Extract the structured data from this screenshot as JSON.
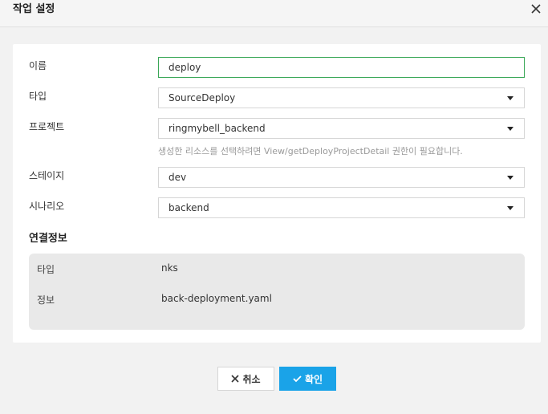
{
  "dialog": {
    "title": "작업 설정"
  },
  "form": {
    "name": {
      "label": "이름",
      "value": "deploy"
    },
    "type": {
      "label": "타입",
      "value": "SourceDeploy"
    },
    "project": {
      "label": "프로젝트",
      "value": "ringmybell_backend",
      "help": "생성한 리소스를 선택하려면 View/getDeployProjectDetail 권한이 필요합니다."
    },
    "stage": {
      "label": "스테이지",
      "value": "dev"
    },
    "scenario": {
      "label": "시나리오",
      "value": "backend"
    }
  },
  "connection": {
    "title": "연결정보",
    "rows": [
      {
        "label": "타입",
        "value": "nks"
      },
      {
        "label": "정보",
        "value": "back-deployment.yaml"
      }
    ]
  },
  "footer": {
    "cancel_label": "취소",
    "ok_label": "확인"
  },
  "colors": {
    "accent": "#1aa3e8",
    "input_focus": "#3aa757"
  },
  "icons": {
    "close": "close-icon",
    "dropdown": "caret-down-icon",
    "cancel": "x-icon",
    "ok": "check-icon"
  }
}
